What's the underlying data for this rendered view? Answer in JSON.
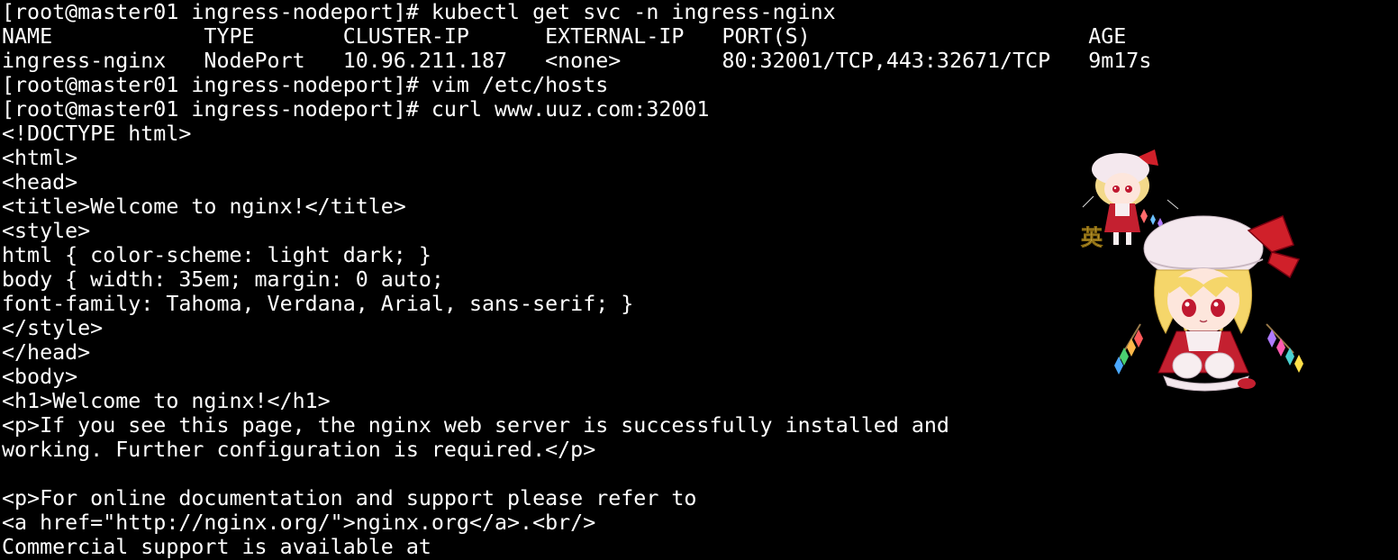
{
  "terminal": {
    "lines": [
      "[root@master01 ingress-nodeport]# kubectl get svc -n ingress-nginx",
      "NAME            TYPE       CLUSTER-IP      EXTERNAL-IP   PORT(S)                      AGE",
      "ingress-nginx   NodePort   10.96.211.187   <none>        80:32001/TCP,443:32671/TCP   9m17s",
      "[root@master01 ingress-nodeport]# vim /etc/hosts",
      "[root@master01 ingress-nodeport]# curl www.uuz.com:32001",
      "<!DOCTYPE html>",
      "<html>",
      "<head>",
      "<title>Welcome to nginx!</title>",
      "<style>",
      "html { color-scheme: light dark; }",
      "body { width: 35em; margin: 0 auto;",
      "font-family: Tahoma, Verdana, Arial, sans-serif; }",
      "</style>",
      "</head>",
      "<body>",
      "<h1>Welcome to nginx!</h1>",
      "<p>If you see this page, the nginx web server is successfully installed and",
      "working. Further configuration is required.</p>",
      "",
      "<p>For online documentation and support please refer to",
      "<a href=\"http://nginx.org/\">nginx.org</a>.<br/>",
      "Commercial support is available at"
    ]
  },
  "decorations": {
    "small_sticker_icon": "chibi-character-sticker-icon",
    "large_sticker_icon": "chibi-character-sticker-icon",
    "small_sticker_char": "英",
    "colors": {
      "background": "#000000",
      "text": "#ffffff",
      "hat": "#f6eef2",
      "hair": "#f5d66a",
      "ribbon": "#d0202a",
      "dress": "#c42030"
    }
  }
}
